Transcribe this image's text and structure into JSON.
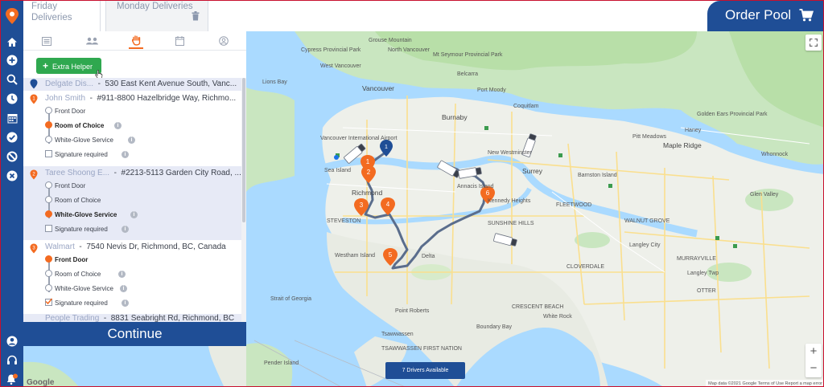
{
  "tabs": [
    {
      "label": "Friday Deliveries"
    },
    {
      "label": "Monday Deliveries"
    }
  ],
  "order_pool": {
    "label": "Order Pool"
  },
  "extra_helper": {
    "label": "Extra Helper"
  },
  "stops": [
    {
      "name": "Delgate Dis...",
      "address": "530 East Kent Avenue South, Vanc...",
      "marker": ""
    },
    {
      "name": "John Smith",
      "address": "#911-8800 Hazelbridge Way, Richmo...",
      "marker": "1",
      "options": [
        "Front Door",
        "Room of Choice",
        "White-Glove Service",
        "Signature required"
      ],
      "selected": "Room of Choice"
    },
    {
      "name": "Taree Shoong E...",
      "address": "#2213-5113 Garden City Road, ...",
      "marker": "2",
      "options": [
        "Front Door",
        "Room of Choice",
        "White-Glove Service",
        "Signature required"
      ],
      "selected": "White-Glove Service"
    },
    {
      "name": "Walmart",
      "address": "7540 Nevis Dr, Richmond, BC, Canada",
      "marker": "3",
      "options": [
        "Front Door",
        "Room of Choice",
        "White-Glove Service",
        "Signature required"
      ],
      "selected": "Front Door"
    },
    {
      "name": "People Trading",
      "address": "8831 Seabright Rd, Richmond, BC",
      "marker": ""
    }
  ],
  "continue": {
    "label": "Continue"
  },
  "map": {
    "drivers_available": "7 Drivers Available",
    "google": "Google",
    "attribution": "Map data ©2021 Google   Terms of Use   Report a map error",
    "zoom_in": "+",
    "zoom_out": "−",
    "labels": {
      "vancouver": "Vancouver",
      "burnaby": "Burnaby",
      "richmond": "Richmond",
      "surrey": "Surrey",
      "new_westminster": "New Westminster",
      "delta": "Delta",
      "north_vancouver": "North Vancouver",
      "west_vancouver": "West Vancouver",
      "coquitlam": "Coquitlam",
      "langley_city": "Langley City",
      "langley_twp": "Langley Twp",
      "maple_ridge": "Maple Ridge",
      "pitt_meadows": "Pitt Meadows",
      "port_moody": "Port Moody",
      "white_rock": "White Rock",
      "tsawwassen": "Tsawwassen",
      "point_roberts": "Point Roberts",
      "pender_island": "Pender Island",
      "vancouver_airport": "Vancouver International Airport",
      "sea_island": "Sea Island",
      "annacis_island": "Annacis Island",
      "westham_island": "Westham Island",
      "golden_ears": "Golden Ears Provincial Park",
      "belcarra": "Belcarra",
      "boundary_bay": "Boundary Bay",
      "steveston": "STEVESTON",
      "fleetwood": "FLEETWOOD",
      "cloverdale": "CLOVERDALE",
      "walnut_grove": "WALNUT GROVE",
      "murrayville": "MURRAYVILLE",
      "strait_of_georgia": "Strait of Georgia",
      "lions_bay": "Lions Bay",
      "cypress": "Cypress Provincial Park",
      "seymour": "Mt Seymour Provincial Park",
      "grouse": "Grouse Mountain",
      "glen_valley": "Glen Valley",
      "whonnock": "Whonnock",
      "haney": "Haney",
      "tswwassen_ferry": "TSAWWASSEN FIRST NATION",
      "crescent_beach": "CRESCENT BEACH",
      "sunshine_hills": "SUNSHINE HILLS",
      "otter": "OTTER",
      "barnston": "Barnston Island",
      "kennedy": "Kennedy Heights"
    },
    "route_markers": [
      "1",
      "2",
      "3",
      "4",
      "5",
      "6"
    ],
    "start_marker": "1"
  },
  "colors": {
    "brand_blue": "#1f4e96",
    "accent_orange": "#f36b21",
    "helper_green": "#2fa84f",
    "route": "#5a6d8c"
  }
}
